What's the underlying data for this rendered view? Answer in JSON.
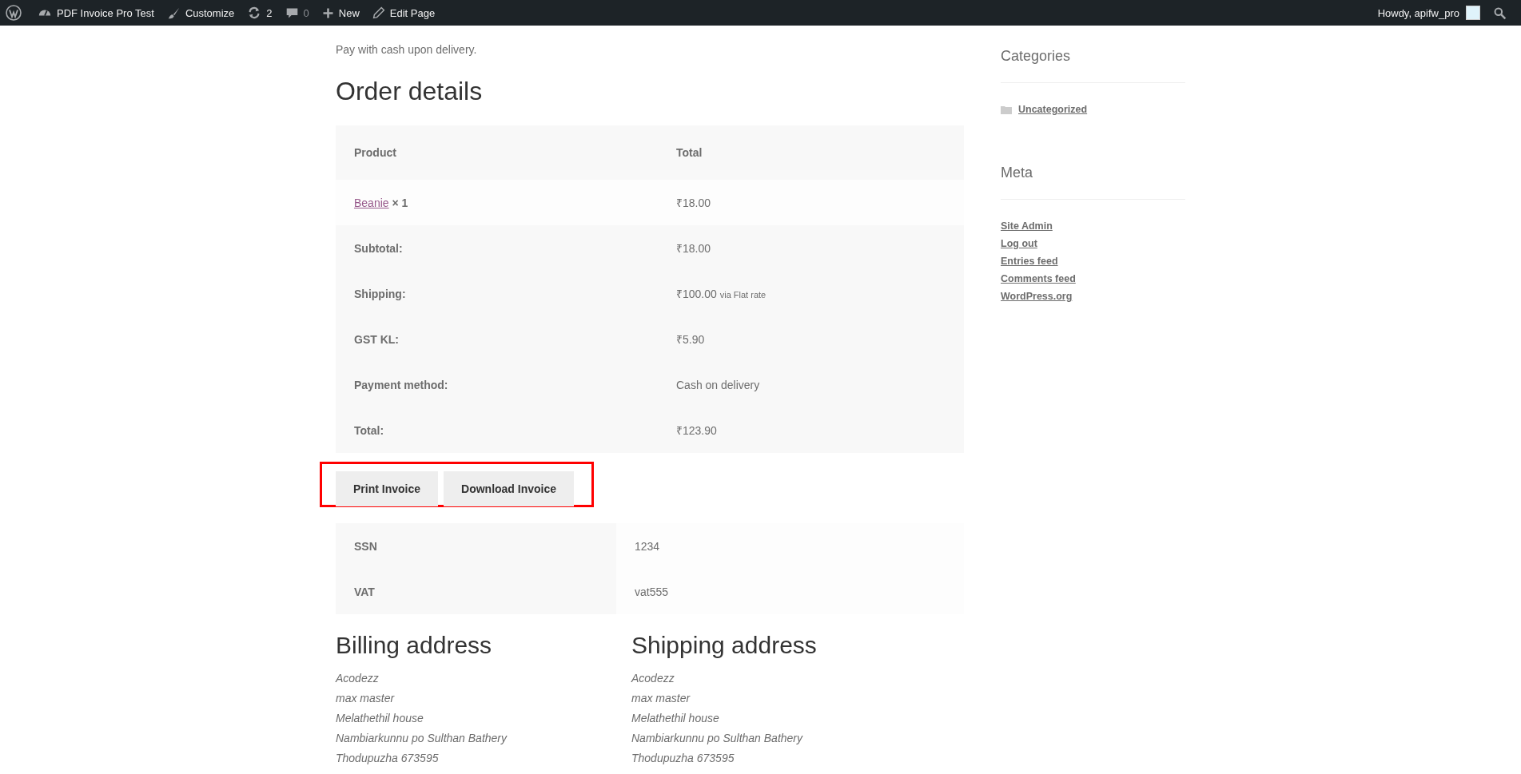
{
  "admin_bar": {
    "items": [
      {
        "kind": "site",
        "label": "PDF Invoice Pro Test"
      },
      {
        "kind": "customize",
        "label": "Customize"
      },
      {
        "kind": "updates",
        "label": "2"
      },
      {
        "kind": "comments",
        "label": "0"
      },
      {
        "kind": "new",
        "label": "New"
      },
      {
        "kind": "edit",
        "label": "Edit Page"
      }
    ],
    "greeting": "Howdy, apifw_pro"
  },
  "intro": "Pay with cash upon delivery.",
  "order_details": {
    "title": "Order details",
    "columns": [
      "Product",
      "Total"
    ],
    "items": [
      {
        "product": "Beanie",
        "quantity": "× 1",
        "total": "₹18.00"
      }
    ],
    "totals": [
      {
        "label": "Subtotal:",
        "value": "₹18.00"
      },
      {
        "label": "Shipping:",
        "value": "₹100.00",
        "note": "via Flat rate"
      },
      {
        "label": "GST KL:",
        "value": "₹5.90"
      },
      {
        "label": "Payment method:",
        "value": "Cash on delivery"
      },
      {
        "label": "Total:",
        "value": "₹123.90"
      }
    ]
  },
  "invoice_buttons": {
    "highlighted": true,
    "buttons": [
      "Print Invoice",
      "Download Invoice"
    ]
  },
  "custom_fields": [
    {
      "label": "SSN",
      "value": "1234"
    },
    {
      "label": "VAT",
      "value": "vat555"
    }
  ],
  "addresses": [
    {
      "title": "Billing address",
      "lines": [
        "Acodezz",
        "max master",
        "Melathethil house",
        "Nambiarkunnu po Sulthan Bathery",
        "Thodupuzha 673595"
      ]
    },
    {
      "title": "Shipping address",
      "lines": [
        "Acodezz",
        "max master",
        "Melathethil house",
        "Nambiarkunnu po Sulthan Bathery",
        "Thodupuzha 673595"
      ]
    }
  ],
  "sidebar": [
    {
      "title": "Categories",
      "kind": "categories",
      "links": [
        "Uncategorized"
      ]
    },
    {
      "title": "Meta",
      "kind": "links",
      "links": [
        "Site Admin",
        "Log out",
        "Entries feed",
        "Comments feed",
        "WordPress.org"
      ]
    }
  ]
}
